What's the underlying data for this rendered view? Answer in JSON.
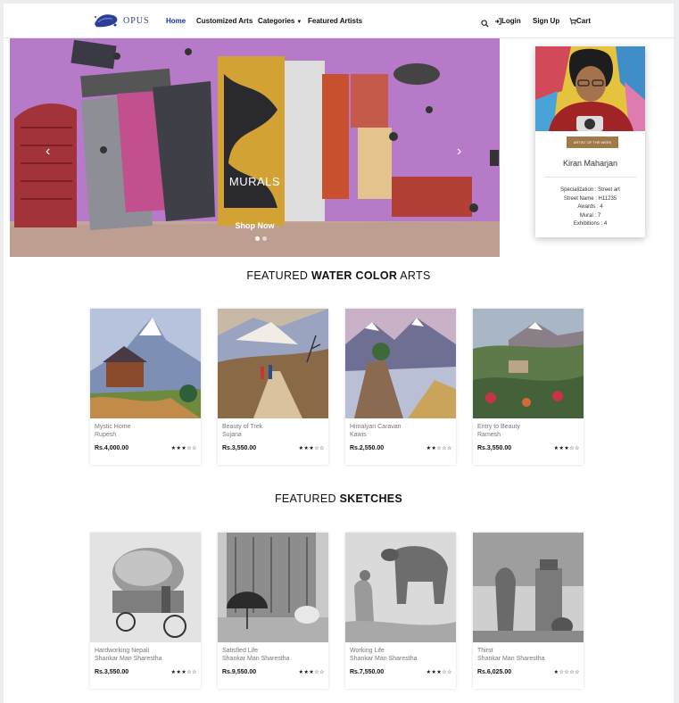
{
  "brand": {
    "name": "OPUS"
  },
  "nav": {
    "home": "Home",
    "customized": "Customized Arts",
    "categories": "Categories",
    "featured_artists": "Featured Artists",
    "login": "Login",
    "signup": "Sign Up",
    "cart": "Cart"
  },
  "hero": {
    "title": "MURALS",
    "button": "Shop Now",
    "slides": 2,
    "active_slide": 1
  },
  "artist": {
    "badge": "ARTIST OF THE WEEK",
    "name": "Kiran Maharjan",
    "specialization": "Specialization : Street art",
    "street_name": "Street Name : H11235",
    "awards": "Awards : 4",
    "mural": "Mural : 7",
    "exhibitions": "Exhibitions : 4"
  },
  "watercolor": {
    "title_pre": "FEATURED",
    "title_bold": "WATER COLOR",
    "title_post": "ARTS",
    "items": [
      {
        "title": "Mystic Home",
        "artist": "Rupesh",
        "price": "Rs.4,000.00",
        "rating": 3
      },
      {
        "title": "Beauty of Trek",
        "artist": "Sujana",
        "price": "Rs.3,550.00",
        "rating": 3
      },
      {
        "title": "Himalyan Caravan",
        "artist": "Kawis",
        "price": "Rs.2,550.00",
        "rating": 2
      },
      {
        "title": "Entry to Beauty",
        "artist": "Ramesh",
        "price": "Rs.3,550.00",
        "rating": 3
      }
    ]
  },
  "sketches": {
    "title_pre": "FEATURED",
    "title_bold": "SKETCHES",
    "items": [
      {
        "title": "Hardworking Nepali",
        "artist": "Shankar Man Sharestha",
        "price": "Rs.3,550.00",
        "rating": 3
      },
      {
        "title": "Satisfied Life",
        "artist": "Shankar Man Sharestha",
        "price": "Rs.9,550.00",
        "rating": 3
      },
      {
        "title": "Working Life",
        "artist": "Shankar Man Sharestha",
        "price": "Rs.7,550.00",
        "rating": 3
      },
      {
        "title": "Thirst",
        "artist": "Shankar Man Sharestha",
        "price": "Rs.6,025.00",
        "rating": 1
      }
    ]
  },
  "stars": {
    "1": "★☆☆☆☆",
    "2": "★★☆☆☆",
    "3": "★★★☆☆"
  },
  "colors": {
    "nav_active": "#1c2f9a",
    "badge": "#a07a48",
    "hero": "#b878c6"
  }
}
